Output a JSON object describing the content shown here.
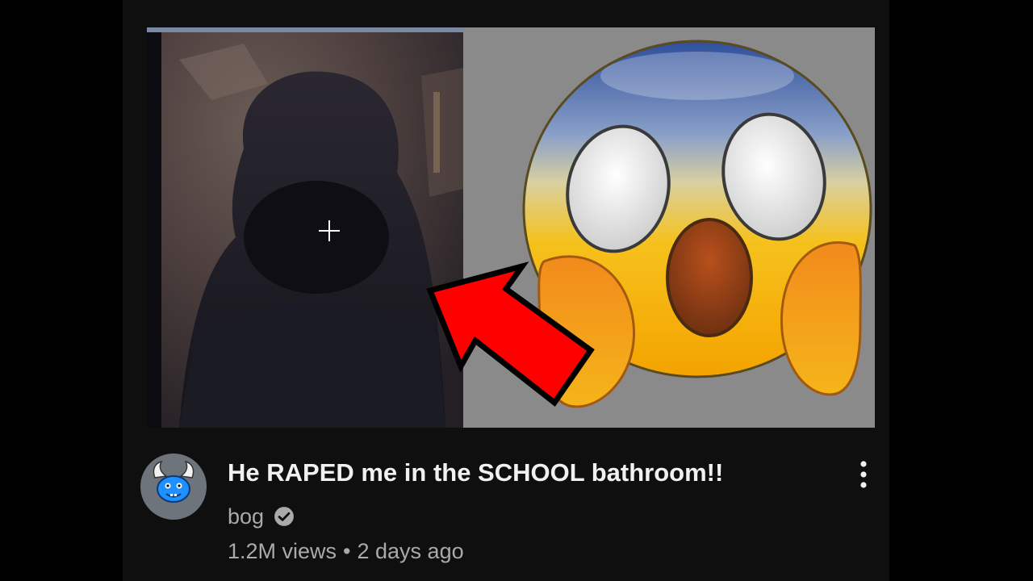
{
  "video": {
    "title": "He RAPED me in the SCHOOL bathroom!!",
    "channel_name": "bog",
    "views": "1.2M views",
    "separator": "•",
    "age": "2 days ago"
  },
  "icons": {
    "avatar": "blue-horned-mascot",
    "verified": "verified-check-icon",
    "more": "more-vertical-icon",
    "arrow": "red-arrow",
    "emoji": "screaming-face-emoji"
  },
  "colors": {
    "background": "#0f0f0f",
    "title": "#f1f1f1",
    "secondary": "#aaaaaa",
    "arrow_red": "#ff0000",
    "avatar_bg": "#6e747c"
  }
}
